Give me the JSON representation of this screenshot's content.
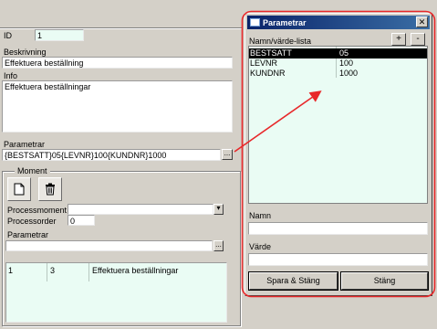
{
  "form": {
    "id_label": "ID",
    "id_value": "1",
    "beskrivning_label": "Beskrivning",
    "beskrivning_value": "Effektuera beställning",
    "info_label": "Info",
    "info_value": "Effektuera beställningar",
    "parametrar_label": "Parametrar",
    "parametrar_value": "{BESTSATT}05{LEVNR}100{KUNDNR}1000",
    "browse_label": "..."
  },
  "moment": {
    "group_label": "Moment",
    "processmoment_label": "Processmoment",
    "processorder_label": "Processorder",
    "processorder_value": "0",
    "parametrar_label": "Parametrar",
    "browse_label": "...",
    "dropdown_arrow": "▾",
    "row": {
      "col1": "1",
      "col2": "3",
      "col3": "Effektuera beställningar"
    }
  },
  "dialog": {
    "title": "Parametrar",
    "close": "✕",
    "list_label": "Namn/värde-lista",
    "add": "+",
    "remove": "-",
    "items": [
      {
        "name": "BESTSATT",
        "value": "05"
      },
      {
        "name": "LEVNR",
        "value": "100"
      },
      {
        "name": "KUNDNR",
        "value": "1000"
      }
    ],
    "namn_label": "Namn",
    "varde_label": "Värde",
    "save_button": "Spara & Stäng",
    "close_button": "Stäng"
  },
  "colors": {
    "annotation": "#e8282a",
    "field_bg": "#eafcf4",
    "title_start": "#0a246a",
    "title_end": "#3a6ea5"
  }
}
